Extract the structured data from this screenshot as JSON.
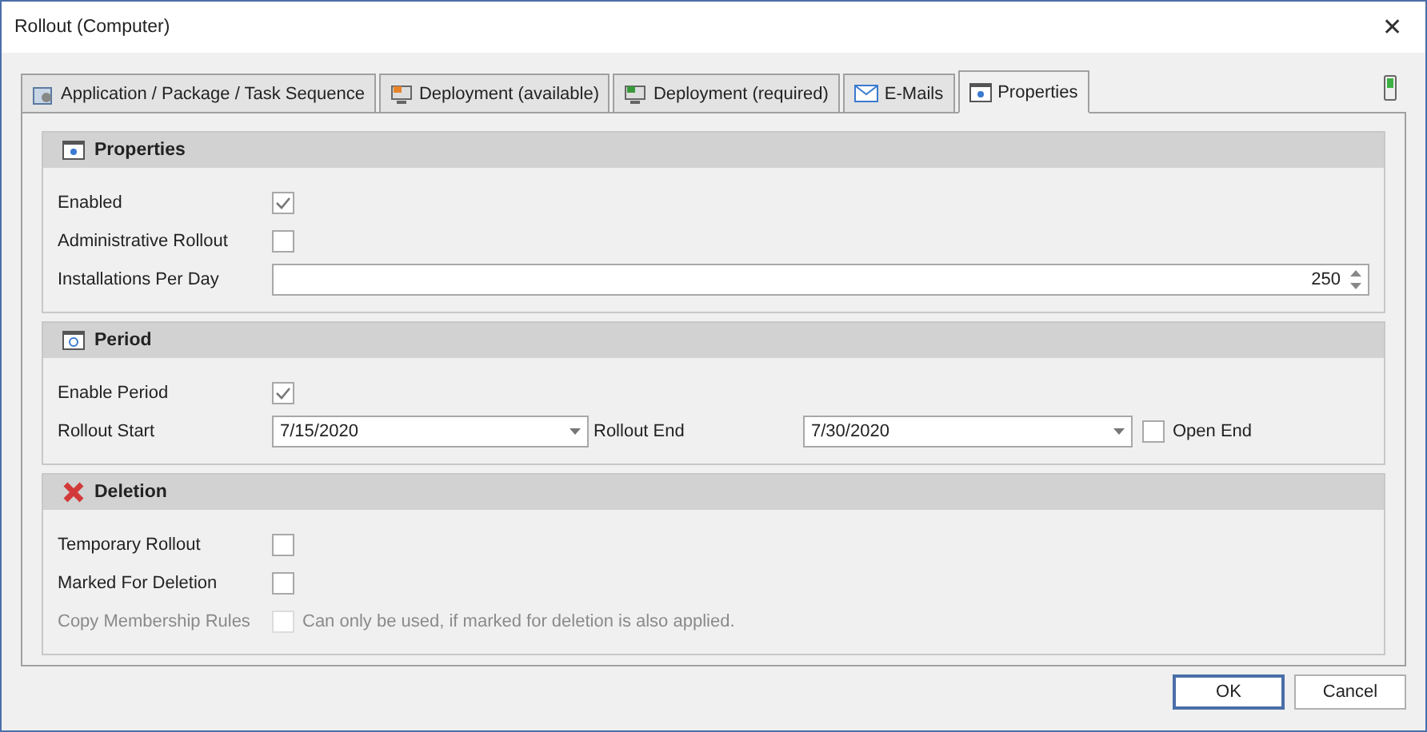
{
  "window": {
    "title": "Rollout (Computer)",
    "close": "✕"
  },
  "tabs": [
    {
      "label": "Application / Package / Task Sequence",
      "kind": "package",
      "selected": false
    },
    {
      "label": "Deployment (available)",
      "kind": "deploy-orange",
      "selected": false
    },
    {
      "label": "Deployment (required)",
      "kind": "deploy-green",
      "selected": false
    },
    {
      "label": "E-Mails",
      "kind": "mail",
      "selected": false
    },
    {
      "label": "Properties",
      "kind": "props",
      "selected": true
    }
  ],
  "sections": [
    {
      "title": "Properties",
      "kind": "props",
      "rows": [
        {
          "kind": "checkbox",
          "label": "Enabled",
          "checked": true,
          "disabled": false
        },
        {
          "kind": "checkbox",
          "label": "Administrative Rollout",
          "checked": false,
          "disabled": false
        },
        {
          "kind": "spin",
          "label": "Installations Per Day",
          "value": "250"
        }
      ]
    },
    {
      "title": "Period",
      "kind": "clock",
      "rows": [
        {
          "kind": "checkbox",
          "label": "Enable Period",
          "checked": true,
          "disabled": false
        },
        {
          "kind": "dates",
          "label": "Rollout Start",
          "value": "7/15/2020",
          "end_label": "Rollout End",
          "end_value": "7/30/2020",
          "open_end": {
            "label": "Open End",
            "checked": false
          }
        }
      ]
    },
    {
      "title": "Deletion",
      "kind": "cross",
      "rows": [
        {
          "kind": "checkbox",
          "label": "Temporary Rollout",
          "checked": false,
          "disabled": false
        },
        {
          "kind": "checkbox",
          "label": "Marked For Deletion",
          "checked": false,
          "disabled": false
        },
        {
          "kind": "checkbox",
          "label": "Copy Membership Rules",
          "checked": false,
          "disabled": true,
          "note": "Can only be used, if marked for deletion is also applied."
        }
      ]
    }
  ],
  "buttons": [
    {
      "label": "OK",
      "default": true
    },
    {
      "label": "Cancel",
      "default": false
    }
  ]
}
